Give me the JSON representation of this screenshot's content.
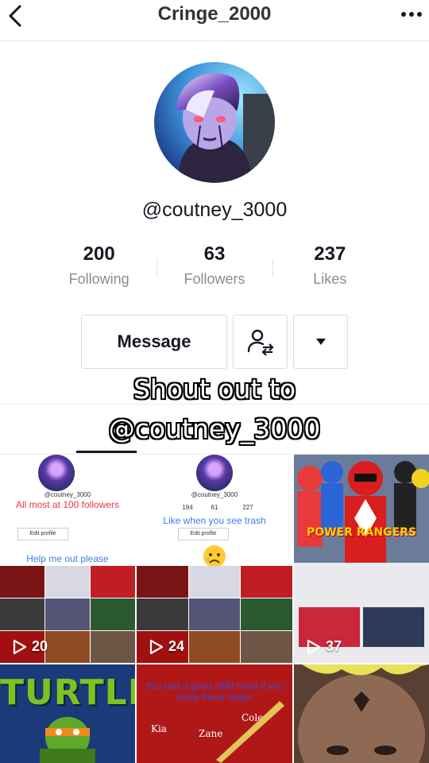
{
  "header": {
    "title": "Cringe_2000",
    "back_icon": "chevron-left-icon",
    "more_icon": "more-horizontal-icon"
  },
  "profile": {
    "username": "@coutney_3000",
    "stats": [
      {
        "value": "200",
        "label": "Following"
      },
      {
        "value": "63",
        "label": "Followers"
      },
      {
        "value": "237",
        "label": "Likes"
      }
    ],
    "message_label": "Message",
    "follow_icon": "user-swap-icon",
    "dropdown_icon": "caret-down-icon"
  },
  "caption": {
    "line1": "Shout out to",
    "line2": "@coutney_3000"
  },
  "videos": [
    {
      "play_count": "20",
      "mini_username": "@coutney_3000",
      "overlay_text": "All most at 100 followers",
      "helper_text": "Help me out please",
      "edit_label": "Edit profile"
    },
    {
      "play_count": "24",
      "mini_username": "@coutney_3000",
      "overlay_text": "Like when you see trash",
      "edit_label": "Edit profile",
      "mini_stats": [
        "194",
        "61",
        "227"
      ]
    },
    {
      "play_count": "37",
      "title_text": "POWER RANGERS"
    },
    {
      "title_text": "TURTLES"
    },
    {
      "overlay_text": "You had a good child hood if you know these ninjas",
      "names": [
        "Kia",
        "Zane",
        "Cole"
      ]
    },
    {}
  ],
  "colors": {
    "text_primary": "#161823",
    "text_secondary": "#8a8b91",
    "divider": "#e3e3e4",
    "caption_fill": "#ffffff"
  }
}
